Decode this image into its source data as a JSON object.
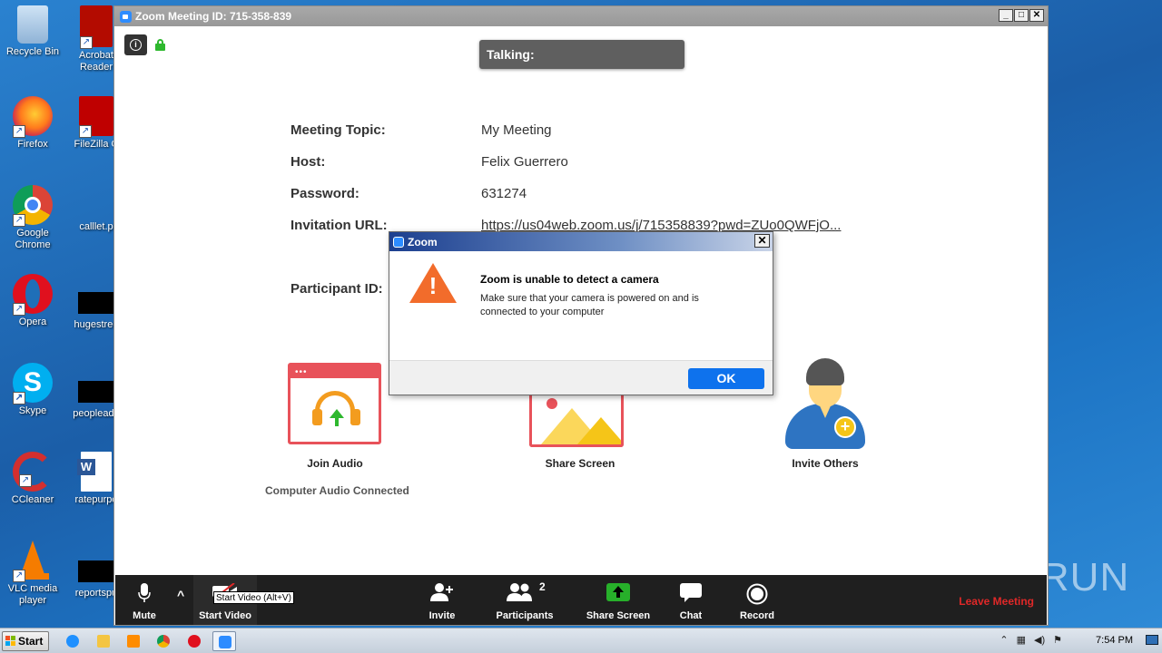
{
  "desktop": {
    "icons": [
      {
        "label": "Recycle Bin"
      },
      {
        "label": "Acrobat Reader"
      },
      {
        "label": "Firefox"
      },
      {
        "label": "FileZilla C"
      },
      {
        "label": "Google Chrome"
      },
      {
        "label": "calllet.p"
      },
      {
        "label": "Opera"
      },
      {
        "label": "hugestree"
      },
      {
        "label": "Skype"
      },
      {
        "label": "peopleadd"
      },
      {
        "label": "CCleaner"
      },
      {
        "label": "ratepurpo"
      },
      {
        "label": "VLC media player"
      },
      {
        "label": "reportspu"
      }
    ],
    "watermark": "ANY RUN"
  },
  "zoom": {
    "title": "Zoom Meeting ID: 715-358-839",
    "talking_label": "Talking:",
    "info": {
      "topic_label": "Meeting Topic:",
      "topic_value": "My Meeting",
      "host_label": "Host:",
      "host_value": "Felix Guerrero",
      "password_label": "Password:",
      "password_value": "631274",
      "url_label": "Invitation URL:",
      "url_value": "https://us04web.zoom.us/j/715358839?pwd=ZUo0QWFjO...",
      "participant_label": "Participant ID:"
    },
    "tiles": {
      "join_audio": "Join Audio",
      "share_screen": "Share Screen",
      "invite_others": "Invite Others",
      "audio_status": "Computer Audio Connected"
    },
    "toolbar": {
      "mute": "Mute",
      "start_video": "Start Video",
      "tooltip": "Start Video (Alt+V)",
      "invite": "Invite",
      "participants": "Participants",
      "participant_count": "2",
      "share_screen": "Share Screen",
      "chat": "Chat",
      "record": "Record",
      "leave": "Leave Meeting"
    }
  },
  "dialog": {
    "title": "Zoom",
    "heading": "Zoom is unable to detect a camera",
    "body": "Make sure that your camera is powered on and is connected to your computer",
    "ok": "OK",
    "close": "✕"
  },
  "taskbar": {
    "start": "Start",
    "clock": "7:54 PM"
  },
  "colors": {
    "zoom_blue": "#0e72ed",
    "warning_orange": "#f26c2b",
    "leave_red": "#e02828",
    "toolbar_bg": "#1f1f1f"
  }
}
